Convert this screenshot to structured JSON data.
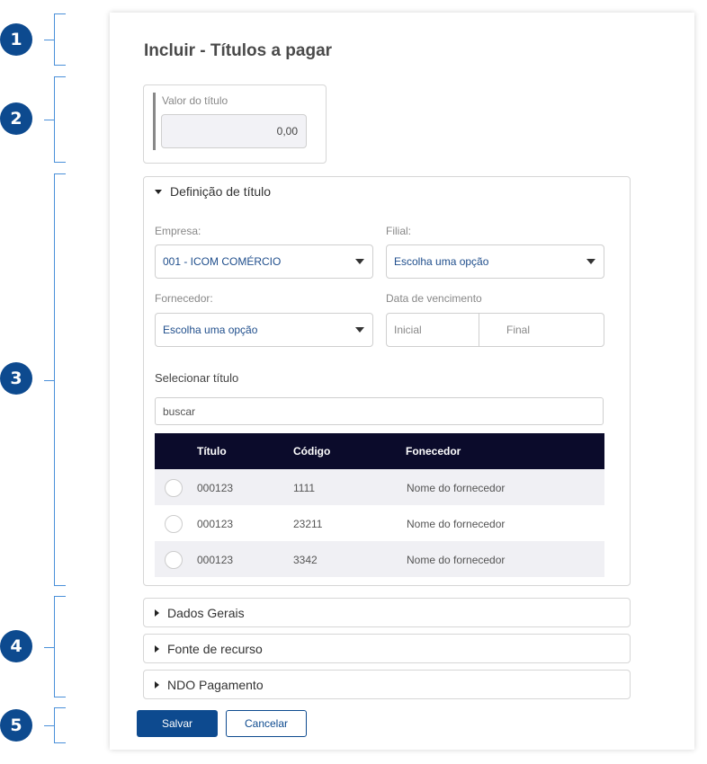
{
  "markers": [
    "1",
    "2",
    "3",
    "4",
    "5"
  ],
  "page_title": "Incluir - Títulos a pagar",
  "valor": {
    "label": "Valor do título",
    "value": "0,00"
  },
  "definicao": {
    "title": "Definição de título",
    "empresa_label": "Empresa:",
    "empresa_value": "001 - ICOM COMÉRCIO",
    "filial_label": "Filial:",
    "filial_value": "Escolha uma opção",
    "fornecedor_label": "Fornecedor:",
    "fornecedor_value": "Escolha uma opção",
    "vencimento_label": "Data de vencimento",
    "vencimento_inicial": "Inicial",
    "vencimento_final": "Final",
    "selecionar_label": "Selecionar título",
    "search_value": "buscar",
    "columns": [
      "Título",
      "Código",
      "Fonecedor"
    ],
    "rows": [
      {
        "titulo": "000123",
        "codigo": "1111",
        "fornecedor": "Nome do fornecedor"
      },
      {
        "titulo": "000123",
        "codigo": "23211",
        "fornecedor": "Nome do fornecedor"
      },
      {
        "titulo": "000123",
        "codigo": "3342",
        "fornecedor": "Nome do fornecedor"
      }
    ]
  },
  "collapsed_sections": [
    "Dados Gerais",
    "Fonte de recurso",
    "NDO Pagamento"
  ],
  "actions": {
    "save": "Salvar",
    "cancel": "Cancelar"
  },
  "colors": {
    "primary": "#0d4a8f",
    "table_header": "#0b0b2b",
    "link_text": "#1f4e8c"
  }
}
